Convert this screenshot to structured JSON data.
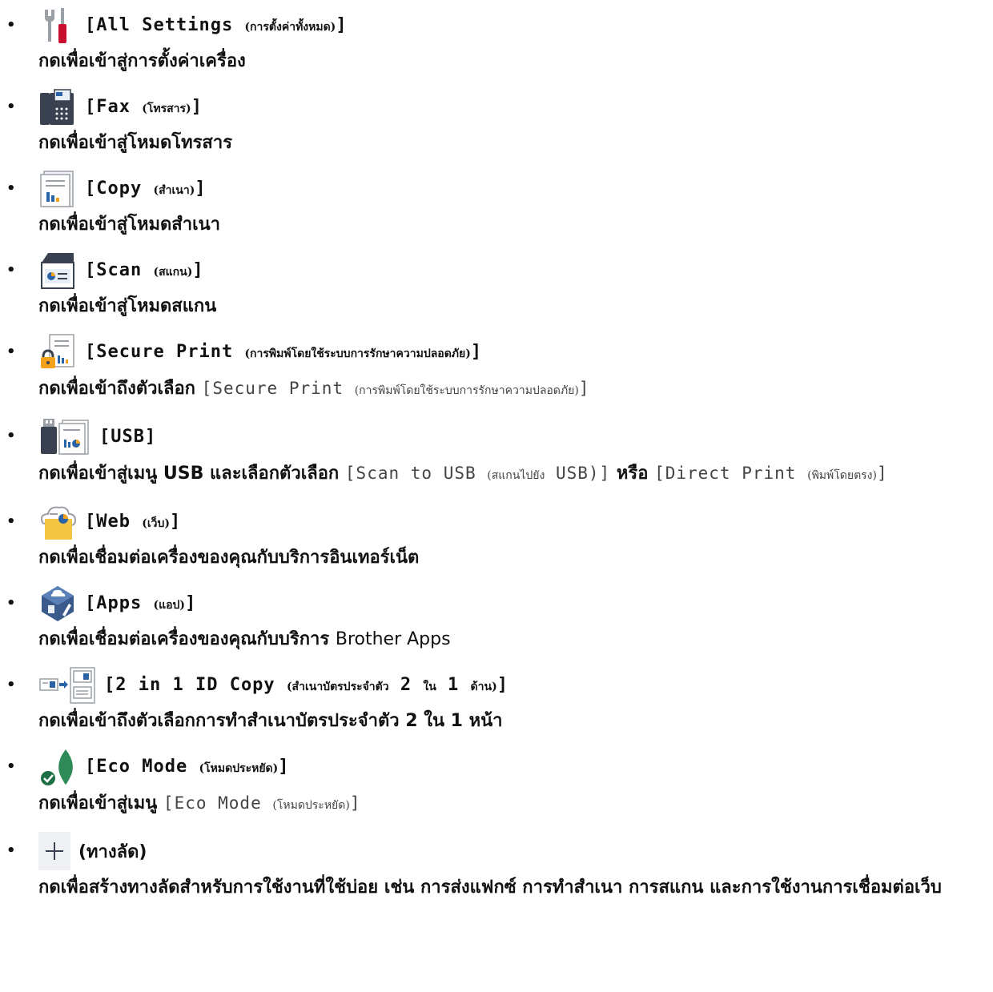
{
  "items": [
    {
      "label": "[All Settings",
      "label_th": "(การตั้งค่าทั้งหมด)",
      "label_end": "]",
      "icon": "tools-icon",
      "desc": "กดเพื่อเข้าสู่การตั้งค่าเครื่อง"
    },
    {
      "label": "[Fax",
      "label_th": "(โทรสาร)",
      "label_end": "]",
      "icon": "fax-icon",
      "desc": "กดเพื่อเข้าสู่โหมดโทรสาร"
    },
    {
      "label": "[Copy",
      "label_th": "(สำเนา)",
      "label_end": "]",
      "icon": "copy-icon",
      "desc": "กดเพื่อเข้าสู่โหมดสำเนา"
    },
    {
      "label": "[Scan",
      "label_th": "(สแกน)",
      "label_end": "]",
      "icon": "scan-icon",
      "desc": "กดเพื่อเข้าสู่โหมดสแกน"
    },
    {
      "label": "[Secure Print",
      "label_th": "(การพิมพ์โดยใช้ระบบการรักษาความปลอดภัย)",
      "label_end": "]",
      "icon": "secure-print-icon",
      "desc_prefix": "กดเพื่อเข้าถึงตัวเลือก",
      "desc_code": "[Secure Print",
      "desc_code_th": "(การพิมพ์โดยใช้ระบบการรักษาความปลอดภัย)",
      "desc_code_end": "]"
    },
    {
      "label": "[USB]",
      "icon": "usb-icon",
      "desc_prefix": "กดเพื่อเข้าสู่เมนู USB และเลือกตัวเลือก",
      "desc_code1": "[Scan to USB",
      "desc_code1_th": "(สแกนไปยัง",
      "desc_code1_end": "USB)]",
      "desc_or": "หรือ",
      "desc_code2": "[Direct Print",
      "desc_code2_th": "(พิมพ์โดยตรง)",
      "desc_code2_end": "]"
    },
    {
      "label": "[Web",
      "label_th": "(เว็บ)",
      "label_end": "]",
      "icon": "web-icon",
      "desc": "กดเพื่อเชื่อมต่อเครื่องของคุณกับบริการอินเทอร์เน็ต"
    },
    {
      "label": "[Apps",
      "label_th": "(แอป)",
      "label_end": "]",
      "icon": "apps-icon",
      "desc_prefix": "กดเพื่อเชื่อมต่อเครื่องของคุณกับบริการ",
      "desc_plain": "Brother Apps"
    },
    {
      "label": "[2 in 1 ID Copy",
      "label_th": "(สำเนาบัตรประจำตัว",
      "label_num1": "2",
      "label_th2": "ใน",
      "label_num2": "1",
      "label_th3": "ด้าน)",
      "label_end": "]",
      "icon": "id-copy-icon",
      "desc": "กดเพื่อเข้าถึงตัวเลือกการทำสำเนาบัตรประจำตัว 2 ใน 1 หน้า"
    },
    {
      "label": "[Eco Mode",
      "label_th": "(โหมดประหยัด)",
      "label_end": "]",
      "icon": "eco-leaf-icon",
      "desc_prefix": "กดเพื่อเข้าสู่เมนู",
      "desc_code": "[Eco Mode",
      "desc_code_th": "(โหมดประหยัด)",
      "desc_code_end": "]"
    },
    {
      "label": "(ทางลัด)",
      "icon": "plus-icon",
      "desc": "กดเพื่อสร้างทางลัดสำหรับการใช้งานที่ใช้บ่อย เช่น การส่งแฟกซ์ การทำสำเนา การสแกน และการใช้งานการเชื่อมต่อเว็บ"
    }
  ],
  "colors": {
    "red": "#c8102e",
    "blue": "#2b63a8",
    "orange": "#f4a21b",
    "green": "#2e8b57"
  }
}
